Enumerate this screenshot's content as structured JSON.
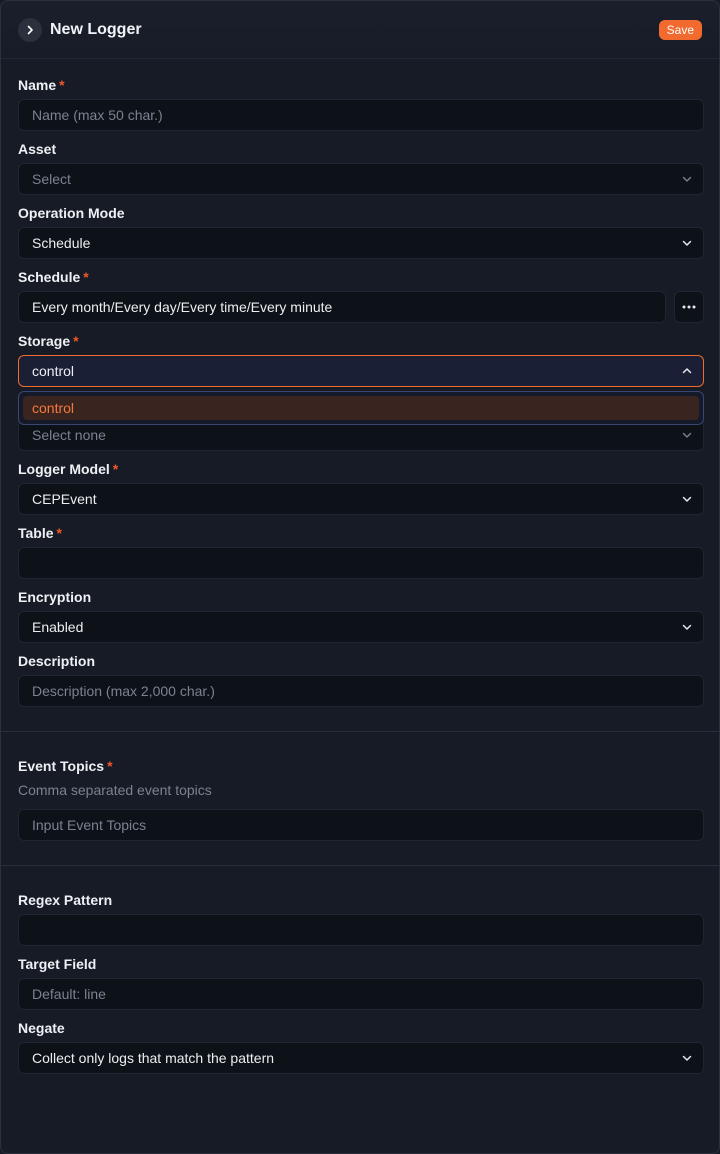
{
  "header": {
    "title": "New Logger",
    "save_label": "Save"
  },
  "form": {
    "name": {
      "label": "Name",
      "placeholder": "Name (max 50 char.)"
    },
    "asset": {
      "label": "Asset",
      "placeholder": "Select"
    },
    "operation_mode": {
      "label": "Operation Mode",
      "value": "Schedule"
    },
    "schedule": {
      "label": "Schedule",
      "value": "Every month/Every day/Every time/Every minute"
    },
    "storage": {
      "label": "Storage",
      "value": "control",
      "options": [
        "control"
      ],
      "below_placeholder": "Select none"
    },
    "logger_model": {
      "label": "Logger Model",
      "value": "CEPEvent"
    },
    "table": {
      "label": "Table",
      "value": ""
    },
    "encryption": {
      "label": "Encryption",
      "value": "Enabled"
    },
    "description": {
      "label": "Description",
      "placeholder": "Description (max 2,000 char.)"
    }
  },
  "event_topics": {
    "label": "Event Topics",
    "hint": "Comma separated event topics",
    "placeholder": "Input Event Topics"
  },
  "regex": {
    "pattern": {
      "label": "Regex Pattern",
      "value": ""
    },
    "target_field": {
      "label": "Target Field",
      "placeholder": "Default: line"
    },
    "negate": {
      "label": "Negate",
      "value": "Collect only logs that match the pattern"
    }
  },
  "colors": {
    "accent": "#f26a2e",
    "required": "#f0572b",
    "background": "#161b26",
    "input": "#0d1118"
  }
}
